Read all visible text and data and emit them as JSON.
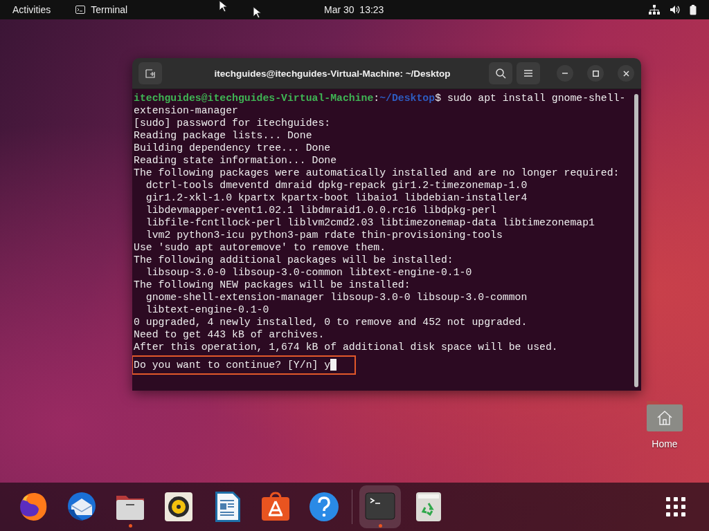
{
  "top_bar": {
    "activities": "Activities",
    "app_menu": "Terminal",
    "clock": "Mar 30  13:23"
  },
  "terminal": {
    "title": "itechguides@itechguides-Virtual-Machine: ~/Desktop",
    "lines": [
      {
        "kind": "prompt",
        "user": "itechguides@itechguides-Virtual-Machine",
        "separator": ":",
        "path": "~/Desktop",
        "command": "$ sudo apt install gnome-shell-"
      },
      {
        "kind": "output",
        "text": "extension-manager"
      },
      {
        "kind": "output",
        "text": "[sudo] password for itechguides:"
      },
      {
        "kind": "output",
        "text": "Reading package lists... Done"
      },
      {
        "kind": "output",
        "text": "Building dependency tree... Done"
      },
      {
        "kind": "output",
        "text": "Reading state information... Done"
      },
      {
        "kind": "output",
        "text": "The following packages were automatically installed and are no longer required:"
      },
      {
        "kind": "output",
        "text": "  dctrl-tools dmeventd dmraid dpkg-repack gir1.2-timezonemap-1.0"
      },
      {
        "kind": "output",
        "text": "  gir1.2-xkl-1.0 kpartx kpartx-boot libaio1 libdebian-installer4"
      },
      {
        "kind": "output",
        "text": "  libdevmapper-event1.02.1 libdmraid1.0.0.rc16 libdpkg-perl"
      },
      {
        "kind": "output",
        "text": "  libfile-fcntllock-perl liblvm2cmd2.03 libtimezonemap-data libtimezonemap1"
      },
      {
        "kind": "output",
        "text": "  lvm2 python3-icu python3-pam rdate thin-provisioning-tools"
      },
      {
        "kind": "output",
        "text": "Use 'sudo apt autoremove' to remove them."
      },
      {
        "kind": "output",
        "text": "The following additional packages will be installed:"
      },
      {
        "kind": "output",
        "text": "  libsoup-3.0-0 libsoup-3.0-common libtext-engine-0.1-0"
      },
      {
        "kind": "output",
        "text": "The following NEW packages will be installed:"
      },
      {
        "kind": "output",
        "text": "  gnome-shell-extension-manager libsoup-3.0-0 libsoup-3.0-common"
      },
      {
        "kind": "output",
        "text": "  libtext-engine-0.1-0"
      },
      {
        "kind": "output",
        "text": "0 upgraded, 4 newly installed, 0 to remove and 452 not upgraded."
      },
      {
        "kind": "output",
        "text": "Need to get 443 kB of archives."
      },
      {
        "kind": "output",
        "text": "After this operation, 1,674 kB of additional disk space will be used."
      },
      {
        "kind": "input",
        "text": "Do you want to continue? [Y/n] y",
        "highlighted": true
      }
    ]
  },
  "desktop_icons": [
    {
      "label": "Home"
    }
  ],
  "dock": {
    "apps": [
      {
        "kind": "browser",
        "running": false,
        "selected": false
      },
      {
        "kind": "mail",
        "running": false,
        "selected": false
      },
      {
        "kind": "files",
        "running": true,
        "selected": false
      },
      {
        "kind": "music",
        "running": false,
        "selected": false
      },
      {
        "kind": "document",
        "running": false,
        "selected": false
      },
      {
        "kind": "software",
        "running": false,
        "selected": false
      },
      {
        "kind": "help",
        "running": false,
        "selected": false
      },
      {
        "kind": "terminal",
        "running": true,
        "selected": true
      },
      {
        "kind": "trash",
        "running": false,
        "selected": false
      }
    ]
  }
}
